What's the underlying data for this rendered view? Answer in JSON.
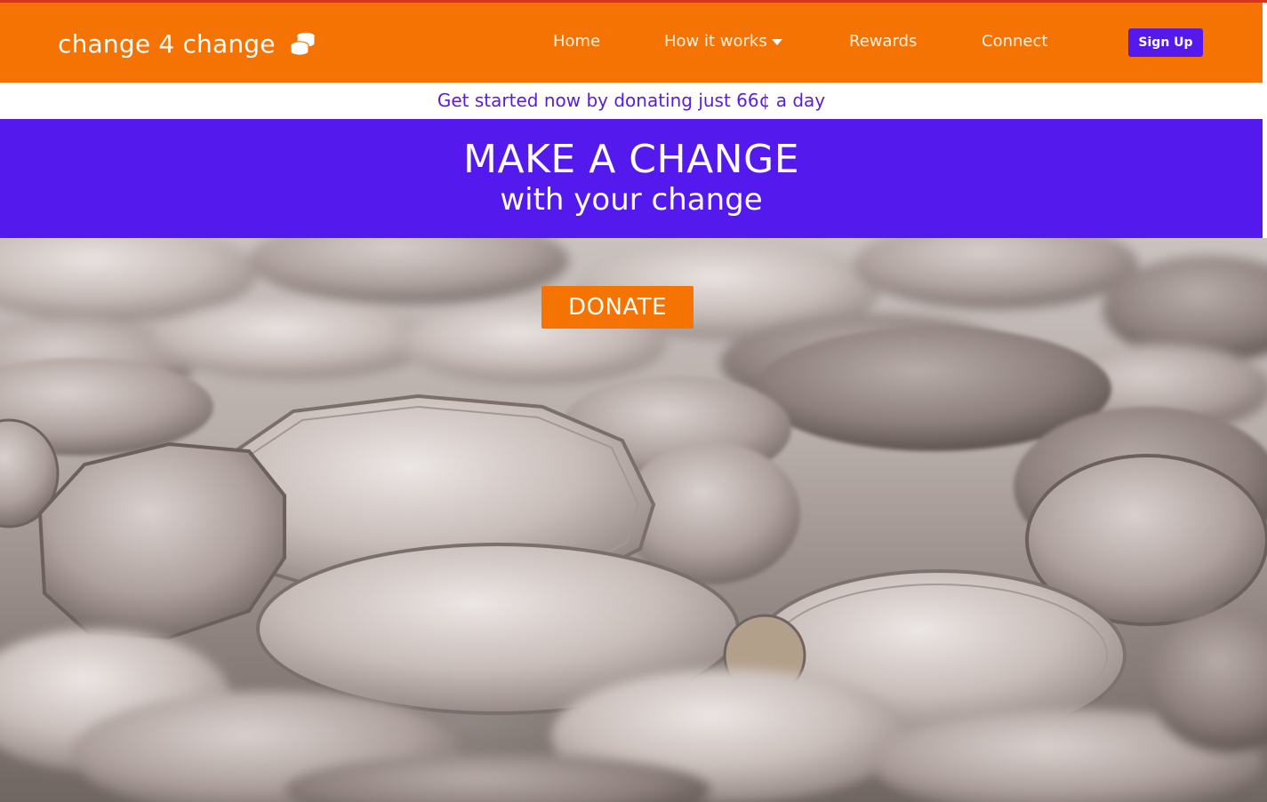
{
  "navbar": {
    "brand": "change 4 change",
    "brand_icon": "coins-icon",
    "links": [
      {
        "label": "Home"
      },
      {
        "label": "How it works",
        "icon": "caret-down-icon"
      },
      {
        "label": "Rewards"
      },
      {
        "label": "Connect"
      }
    ],
    "signup_label": "Sign Up"
  },
  "announcement": {
    "text": "Get started now by donating just 66¢ a day"
  },
  "hero": {
    "title": "MAKE A CHANGE",
    "subtitle": "with your change"
  },
  "cta": {
    "donate_label": "DONATE"
  },
  "colors": {
    "primary_orange": "#f47303",
    "primary_purple": "#5419ed",
    "announcement_text": "#5a1de0",
    "top_accent": "#d4361a"
  }
}
